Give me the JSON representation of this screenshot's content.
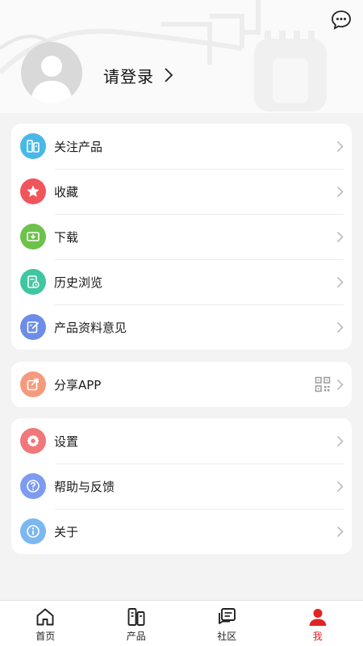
{
  "header": {
    "login_text": "请登录"
  },
  "menu_group_1": {
    "items": [
      {
        "label": "关注产品",
        "icon": "product-follow-icon",
        "color": "#4ab8e6"
      },
      {
        "label": "收藏",
        "icon": "star-icon",
        "color": "#f0555c"
      },
      {
        "label": "下载",
        "icon": "download-icon",
        "color": "#6cc24a"
      },
      {
        "label": "历史浏览",
        "icon": "history-icon",
        "color": "#3fc6a2"
      },
      {
        "label": "产品资料意见",
        "icon": "edit-icon",
        "color": "#6e8de8"
      }
    ]
  },
  "menu_group_2": {
    "items": [
      {
        "label": "分享APP",
        "icon": "share-icon",
        "color": "#f49b7e"
      }
    ]
  },
  "menu_group_3": {
    "items": [
      {
        "label": "设置",
        "icon": "settings-icon",
        "color": "#f0777a"
      },
      {
        "label": "帮助与反馈",
        "icon": "help-icon",
        "color": "#7d9bf0"
      },
      {
        "label": "关于",
        "icon": "info-icon",
        "color": "#7bb8f0"
      }
    ]
  },
  "tabbar": {
    "items": [
      {
        "label": "首页",
        "icon": "home-icon",
        "active": false
      },
      {
        "label": "产品",
        "icon": "product-icon",
        "active": false
      },
      {
        "label": "社区",
        "icon": "community-icon",
        "active": false
      },
      {
        "label": "我",
        "icon": "profile-icon",
        "active": true
      }
    ],
    "active_color": "#e02424"
  }
}
